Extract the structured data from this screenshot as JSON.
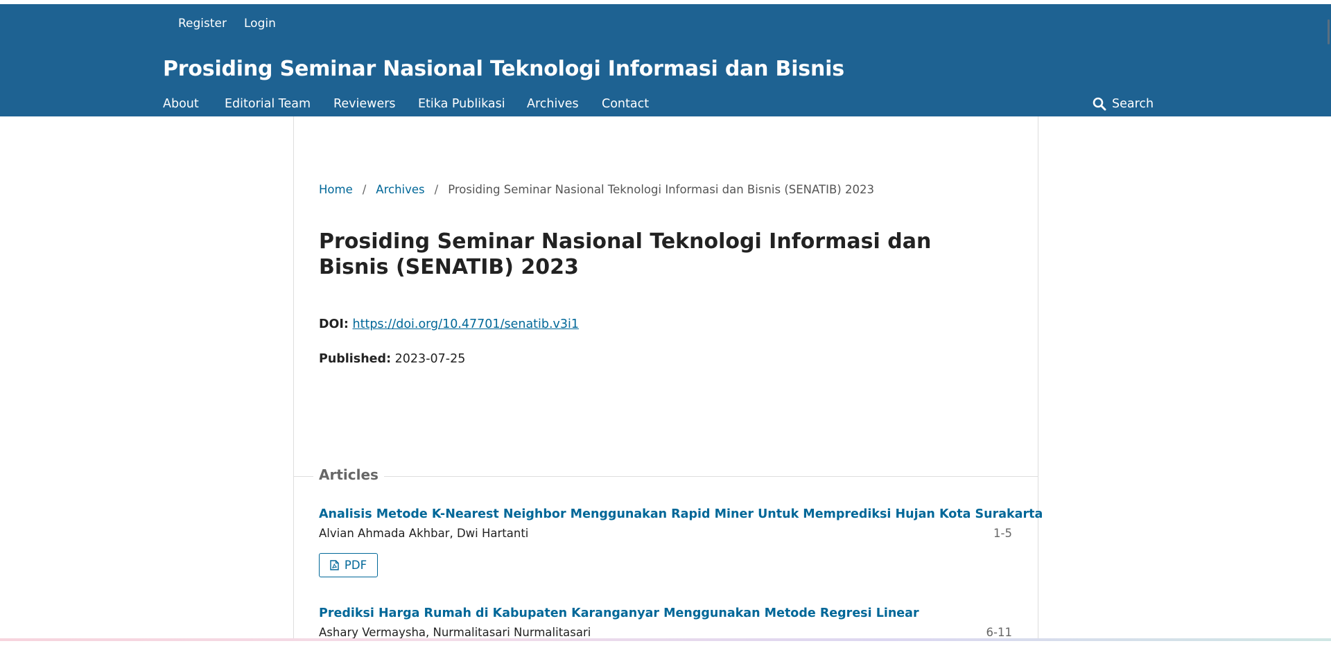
{
  "header": {
    "site_title": "Prosiding Seminar Nasional Teknologi Informasi dan Bisnis",
    "user_nav": {
      "register": "Register",
      "login": "Login"
    },
    "nav": {
      "about": "About",
      "editorial_team": "Editorial Team",
      "reviewers": "Reviewers",
      "etika_publikasi": "Etika Publikasi",
      "archives": "Archives",
      "contact": "Contact"
    },
    "search": "Search"
  },
  "breadcrumb": {
    "home": "Home",
    "archives": "Archives",
    "current": "Prosiding Seminar Nasional Teknologi Informasi dan Bisnis (SENATIB) 2023"
  },
  "issue": {
    "title": "Prosiding Seminar Nasional Teknologi Informasi dan Bisnis (SENATIB) 2023",
    "doi_label": "DOI:",
    "doi": "https://doi.org/10.47701/senatib.v3i1",
    "published_label": "Published:",
    "published": "2023-07-25"
  },
  "section": {
    "title": "Articles"
  },
  "articles": [
    {
      "title": "Analisis Metode K-Nearest Neighbor Menggunakan Rapid Miner Untuk Memprediksi Hujan Kota Surakarta",
      "authors": "Alvian Ahmada Akhbar, Dwi Hartanti",
      "pages": "1-5",
      "pdf_label": "PDF"
    },
    {
      "title": "Prediksi Harga Rumah di Kabupaten Karanganyar Menggunakan Metode Regresi Linear",
      "authors": "Ashary Vermaysha, Nurmalitasari Nurmalitasari",
      "pages": "6-11"
    }
  ],
  "colors": {
    "header_bg": "#1e6292",
    "link": "#006798",
    "text": "#222222",
    "muted": "#666666",
    "border": "#dddddd"
  },
  "icons": {
    "search": "search-icon",
    "pdf": "file-pdf-icon"
  }
}
